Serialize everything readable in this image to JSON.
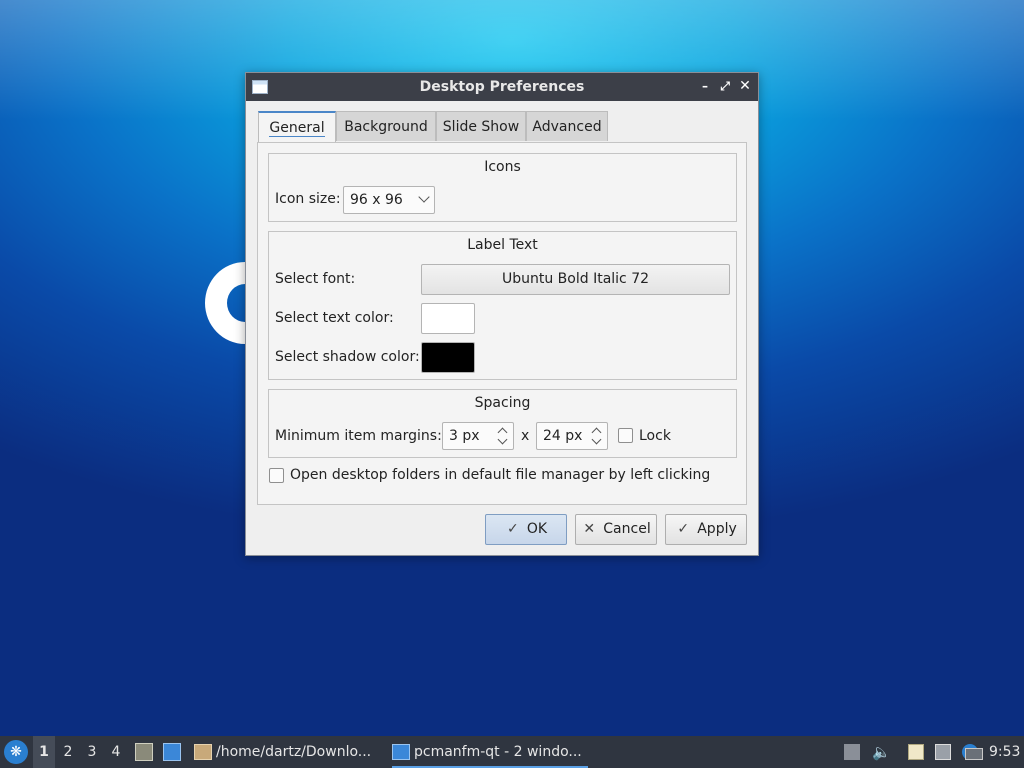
{
  "dialog": {
    "title": "Desktop Preferences",
    "tabs": [
      "General",
      "Background",
      "Slide Show",
      "Advanced"
    ],
    "icons_group": {
      "title": "Icons",
      "icon_size_label": "Icon size:",
      "icon_size_value": "96 x 96"
    },
    "label_group": {
      "title": "Label Text",
      "select_font_label": "Select font:",
      "font_value": "Ubuntu Bold Italic 72",
      "text_color_label": "Select text color:",
      "text_color": "#ffffff",
      "shadow_color_label": "Select shadow color:",
      "shadow_color": "#000000"
    },
    "spacing_group": {
      "title": "Spacing",
      "margins_label": "Minimum item margins:",
      "margin_x": "3 px",
      "separator": "x",
      "margin_y": "24 px",
      "lock_label": "Lock",
      "lock_checked": false
    },
    "open_folders_label": "Open desktop folders in default file manager by left clicking",
    "open_folders_checked": false,
    "buttons": {
      "ok": "OK",
      "cancel": "Cancel",
      "apply": "Apply"
    }
  },
  "taskbar": {
    "workspaces": [
      "1",
      "2",
      "3",
      "4"
    ],
    "active_workspace": "1",
    "tasks": [
      {
        "label": "/home/dartz/Downlo..."
      },
      {
        "label": "pcmanfm-qt - 2 windo..."
      }
    ],
    "clock": "9:53"
  },
  "icons": {
    "window_controls": [
      "minimize-icon",
      "maximize-icon",
      "close-icon"
    ],
    "tray": [
      "upload-icon",
      "volume-icon",
      "clipboard-icon",
      "network-icon",
      "notification-icon",
      "display-icon"
    ]
  },
  "colors": {
    "titlebar": "#3c3f48",
    "taskbar": "#2f3540",
    "accent": "#4a86c8"
  }
}
